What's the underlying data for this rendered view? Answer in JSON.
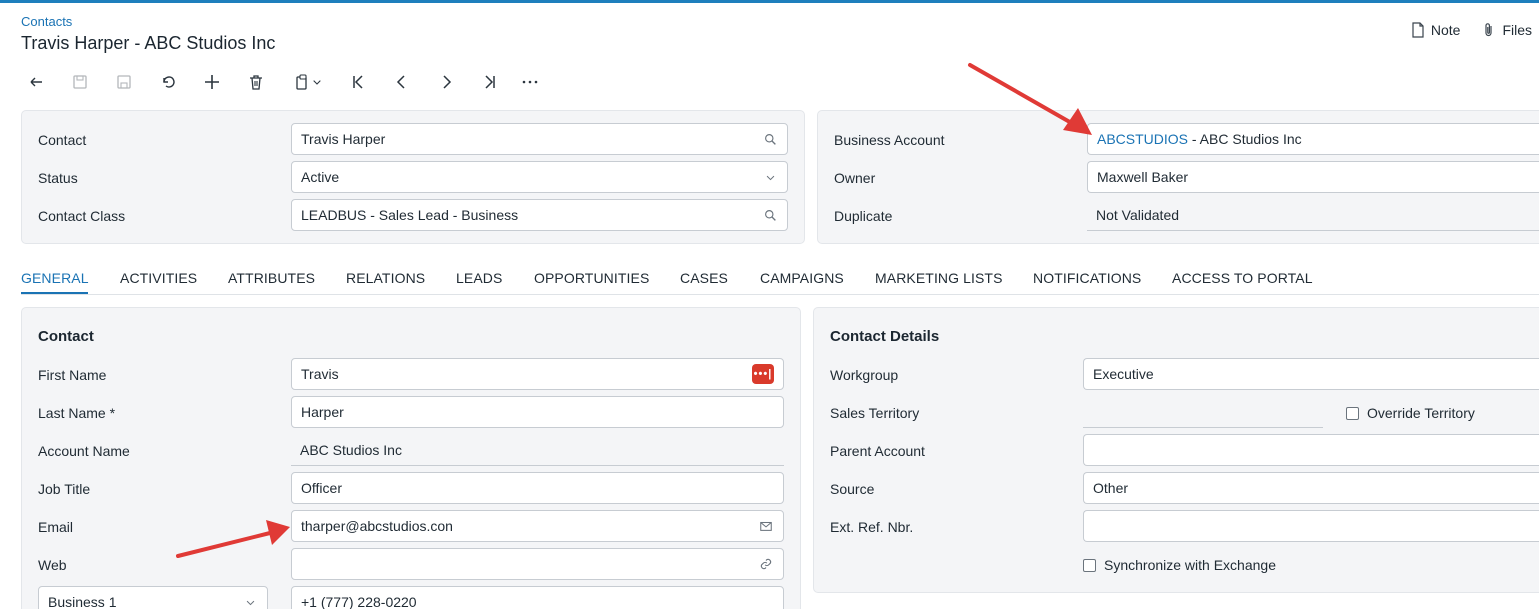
{
  "breadcrumb": "Contacts",
  "page_title": "Travis Harper - ABC Studios Inc",
  "top_actions": {
    "note": "Note",
    "files": "Files"
  },
  "toolbar": {
    "buttons": [
      "back-icon",
      "save-close-icon",
      "save-icon",
      "undo-icon",
      "add-icon",
      "delete-icon",
      "clipboard-icon",
      "first-icon",
      "previous-icon",
      "next-icon",
      "last-icon",
      "more-icon"
    ]
  },
  "summary": {
    "contact_label": "Contact",
    "contact_value": "Travis Harper",
    "status_label": "Status",
    "status_value": "Active",
    "contact_class_label": "Contact Class",
    "contact_class_value": "LEADBUS - Sales Lead - Business",
    "business_account_label": "Business Account",
    "business_account_code": "ABCSTUDIOS",
    "business_account_name": " - ABC Studios Inc",
    "owner_label": "Owner",
    "owner_value": "Maxwell Baker",
    "duplicate_label": "Duplicate",
    "duplicate_value": "Not Validated"
  },
  "tabs": [
    "GENERAL",
    "ACTIVITIES",
    "ATTRIBUTES",
    "RELATIONS",
    "LEADS",
    "OPPORTUNITIES",
    "CASES",
    "CAMPAIGNS",
    "MARKETING LISTS",
    "NOTIFICATIONS",
    "ACCESS TO PORTAL"
  ],
  "active_tab": "GENERAL",
  "contact_section": {
    "title": "Contact",
    "first_name_label": "First Name",
    "first_name_value": "Travis",
    "last_name_label": "Last Name",
    "last_name_required": "*",
    "last_name_value": "Harper",
    "account_name_label": "Account Name",
    "account_name_value": "ABC Studios Inc",
    "job_title_label": "Job Title",
    "job_title_value": "Officer",
    "email_label": "Email",
    "email_value": "tharper@abcstudios.con",
    "web_label": "Web",
    "web_value": "",
    "phone_type_value": "Business 1",
    "phone_value": "+1 (777) 228-0220"
  },
  "details_section": {
    "title": "Contact Details",
    "workgroup_label": "Workgroup",
    "workgroup_value": "Executive",
    "sales_territory_label": "Sales Territory",
    "sales_territory_value": "",
    "override_territory_label": "Override Territory",
    "override_territory_checked": false,
    "parent_account_label": "Parent Account",
    "parent_account_value": "",
    "source_label": "Source",
    "source_value": "Other",
    "ext_ref_label": "Ext. Ref. Nbr.",
    "ext_ref_value": "",
    "sync_exchange_label": "Synchronize with Exchange",
    "sync_exchange_checked": false
  },
  "colors": {
    "accent": "#1a73b4",
    "annotation_arrow": "#e03a36",
    "panel_bg": "#f4f5f7"
  }
}
